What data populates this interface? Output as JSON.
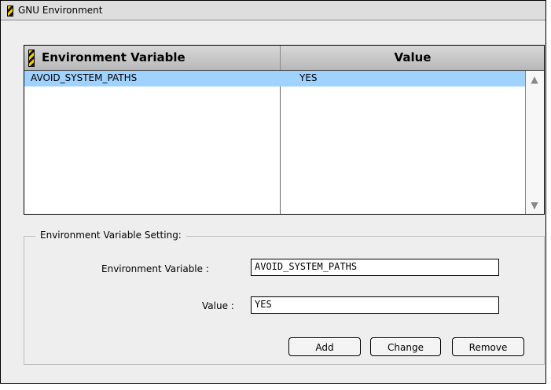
{
  "window": {
    "title": "GNU Environment"
  },
  "table": {
    "columns": [
      "Environment Variable",
      "Value"
    ],
    "rows": [
      {
        "variable": "AVOID_SYSTEM_PATHS",
        "value": "YES"
      }
    ]
  },
  "setting": {
    "group_label": "Environment Variable Setting:",
    "variable_label": "Environment Variable :",
    "variable_value": "AVOID_SYSTEM_PATHS",
    "value_label": "Value :",
    "value_value": "YES"
  },
  "buttons": {
    "add": "Add",
    "change": "Change",
    "remove": "Remove"
  },
  "icons": {
    "window_icon": "hazard-stripe-icon",
    "column_icon": "hazard-stripe-icon",
    "scroll_up": "scroll-up-arrow-icon",
    "scroll_down": "scroll-down-arrow-icon"
  }
}
